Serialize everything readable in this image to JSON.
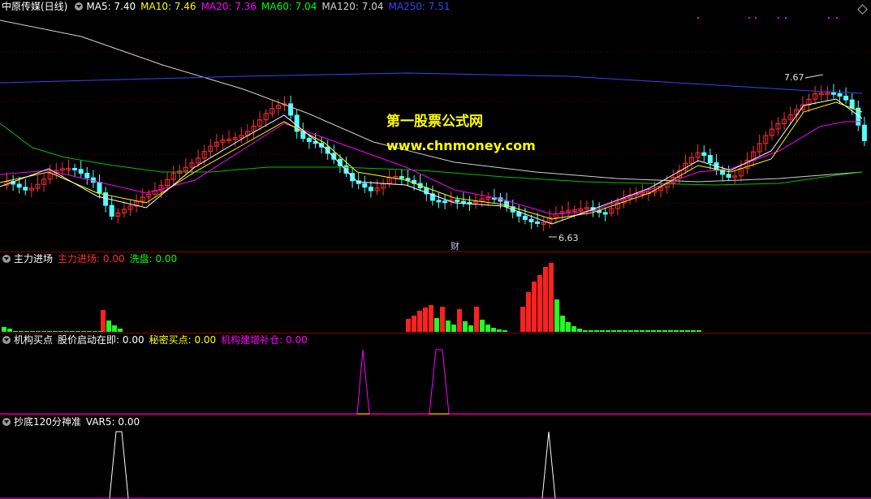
{
  "main_panel": {
    "title": "中原传媒(日线)",
    "ma_legend": [
      {
        "label": "MA5: 7.40",
        "color": "#ffffff"
      },
      {
        "label": "MA10: 7.46",
        "color": "#ffff00"
      },
      {
        "label": "MA20: 7.36",
        "color": "#ff00ff"
      },
      {
        "label": "MA60: 7.04",
        "color": "#00ff00"
      },
      {
        "label": "MA120: 7.04",
        "color": "#d0d0d0"
      },
      {
        "label": "MA250: 7.51",
        "color": "#3f3fff"
      }
    ],
    "high_marker": "7.67",
    "low_marker": "6.63",
    "event_marker": "财",
    "watermark_cn": "第一股票公式网",
    "watermark_url": "www.chnmoney.com"
  },
  "panel_main_force": {
    "title": "主力进场",
    "items": [
      {
        "label": "主力进场: 0.00",
        "color": "#ff3030"
      },
      {
        "label": "洗盘: 0.00",
        "color": "#00ff00"
      }
    ]
  },
  "panel_institution": {
    "title": "机构买点",
    "items": [
      {
        "label": "股价启动在即: 0.00",
        "color": "#ffffff"
      },
      {
        "label": "秘密买点: 0.00",
        "color": "#ffff00"
      },
      {
        "label": "机构建增补仓: 0.00",
        "color": "#ff00ff"
      }
    ]
  },
  "panel_bottom": {
    "title": "抄底120分神准",
    "items": [
      {
        "label": "VAR5: 0.00",
        "color": "#ffffff"
      }
    ]
  },
  "colors": {
    "up": "#ff3030",
    "down": "#54ffff",
    "separator": "#8b0000"
  }
}
